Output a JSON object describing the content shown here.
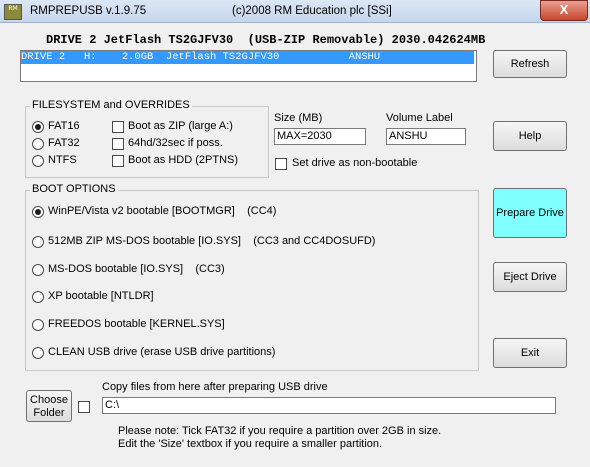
{
  "window": {
    "title": "RMPREPUSB v.1.9.75",
    "copyright": "(c)2008 RM Education plc [SSi]",
    "close_label": "X",
    "icon_text": "RM"
  },
  "drive": {
    "header": "DRIVE 2 JetFlash TS2GJFV30  (USB-ZIP Removable) 2030.042624MB",
    "list_row": "DRIVE 2   H:    2.0GB  JetFlash TS2GJFV30           ANSHU"
  },
  "buttons": {
    "refresh": "Refresh",
    "help": "Help",
    "prepare": "Prepare Drive",
    "eject": "Eject Drive",
    "exit": "Exit",
    "choose_folder": "Choose Folder"
  },
  "filesystem": {
    "legend": "FILESYSTEM and OVERRIDES",
    "radios": [
      "FAT16",
      "FAT32",
      "NTFS"
    ],
    "selected": "FAT16",
    "overrides": [
      "Boot as ZIP (large A:)",
      "64hd/32sec if poss.",
      "Boot as HDD (2PTNS)"
    ]
  },
  "size": {
    "label": "Size (MB)",
    "value": "MAX=2030"
  },
  "volume": {
    "label": "Volume Label",
    "value": "ANSHU"
  },
  "nonbootable_label": "Set drive as non-bootable",
  "boot": {
    "legend": "BOOT OPTIONS",
    "options": [
      "WinPE/Vista v2 bootable [BOOTMGR]    (CC4)",
      "512MB ZIP MS-DOS bootable [IO.SYS]    (CC3 and CC4DOSUFD)",
      "MS-DOS bootable [IO.SYS]    (CC3)",
      "XP bootable [NTLDR]",
      "FREEDOS bootable [KERNEL.SYS]",
      "CLEAN USB drive (erase USB drive partitions)"
    ],
    "selected_index": 0
  },
  "copy": {
    "label": "Copy files from here after preparing USB drive",
    "path": "C:\\",
    "note1": "Please note: Tick FAT32 if you require a partition over 2GB in size.",
    "note2": "Edit the 'Size' textbox if you require a smaller partition."
  },
  "colors": {
    "selection": "#3399ff",
    "prepare_button": "#80ffff"
  }
}
